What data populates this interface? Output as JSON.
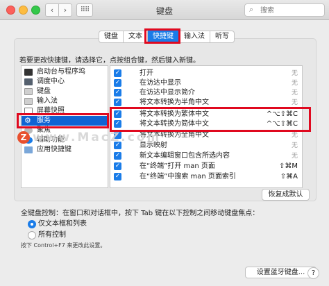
{
  "window": {
    "title": "键盘"
  },
  "search": {
    "placeholder": "搜索"
  },
  "tabs": [
    "键盘",
    "文本",
    "快捷键",
    "输入法",
    "听写"
  ],
  "instruction": "若要更改快捷键，请选择它，点按组合键，然后键入新键。",
  "categories": [
    "启动台与程序坞",
    "调度中心",
    "键盘",
    "输入法",
    "屏幕快照",
    "服务",
    "聚焦",
    "辅助功能",
    "应用快捷键"
  ],
  "shortcuts": [
    {
      "name": "打开",
      "key": "无"
    },
    {
      "name": "在访达中显示",
      "key": "无"
    },
    {
      "name": "在访达中显示简介",
      "key": "无"
    },
    {
      "name": "将文本转换为半角中文",
      "key": "无"
    },
    {
      "name": "将文本转换为繁体中文",
      "key": "^⌥⇧⌘C"
    },
    {
      "name": "将文本转换为简体中文",
      "key": "^⌥⇧⌘C"
    },
    {
      "name": "将文本转换为全角中文",
      "key": "无"
    },
    {
      "name": "显示映射",
      "key": "无"
    },
    {
      "name": "新文本编辑窗口包含所选内容",
      "key": "无"
    },
    {
      "name": "在“终端”打开 man 页面",
      "key": "⇧⌘M"
    },
    {
      "name": "在“终端”中搜索 man 页面索引",
      "key": "⇧⌘A"
    }
  ],
  "restore_label": "恢复成默认",
  "keyboard_control": {
    "label": "全键盘控制：在窗口和对话框中，按下 Tab 键在以下控制之间移动键盘焦点：",
    "options": [
      "仅文本框和列表",
      "所有控制"
    ],
    "hint": "按下 Control+F7 来更改此设置。"
  },
  "bluetooth_button": "设置蓝牙键盘...",
  "help_label": "?",
  "watermark": "www.MacZ.com",
  "colors": {
    "accent": "#1a7ce8",
    "selection": "#0f63d3",
    "highlight": "#e0091f"
  }
}
